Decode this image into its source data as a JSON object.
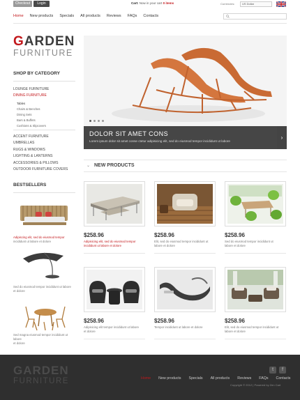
{
  "topbar": {
    "checkout": "Checkout",
    "login": "Login",
    "cart_label": "Cart:",
    "cart_text": "Now in your cart",
    "cart_items": "0 items",
    "currencies_label": "Currencies:",
    "currency_value": "US Dollar"
  },
  "nav": [
    "Home",
    "New products",
    "Specials",
    "All products",
    "Reviews",
    "FAQs",
    "Contacts"
  ],
  "logo": {
    "line1_first": "G",
    "line1_rest": "ARDEN",
    "line2": "FURNITURE"
  },
  "sidebar": {
    "category_heading": "SHOP BY CATEGORY",
    "categories_top": [
      "Lounge Furniture",
      "Dining Furniture"
    ],
    "subcategories": [
      "Tables",
      "Chairs & Benches",
      "Dining Sets",
      "Bars & Buffets",
      "Cushions & Slipcovers"
    ],
    "categories_bottom": [
      "Accent Furniture",
      "Umbrellas",
      "Rugs & Windows",
      "Lighting & Lanterns",
      "Accessories & Pillows",
      "Outdoor Furniture Covers"
    ],
    "bestsellers_heading": "BESTSELLERS",
    "bestsellers": [
      {
        "line1": "Adipiscing elit, sed do eiusmod tempor",
        "line2": "incididunt ut labore et dolore"
      },
      {
        "line1": "Sed do eiusmod tempor incididunt ut labore",
        "line2": "et dolore"
      },
      {
        "line1": "Sed magna eiusmod tempor incididunt ut labore",
        "line2": "et dolore"
      }
    ]
  },
  "slider": {
    "title": "DOLOR SIT AMET CONS",
    "text": "Lorem ipsum dolor sit amet conse ctetur adipisicing elit, sed do eiusmod tempor incididunt ut labore"
  },
  "new_products": {
    "heading": "NEW PRODUCTS",
    "items": [
      {
        "price": "$258.96",
        "line1": "Adipisicing elit, sed do eiusmod tempor",
        "line2": "incididunt ut labore et dolore",
        "highlight": true
      },
      {
        "price": "$258.96",
        "line1": "Elit, sed do eiusmod tempor incididunt ut",
        "line2": "labore et dolore",
        "highlight": false
      },
      {
        "price": "$258.96",
        "line1": "Sed do eiusmod tempor incididunt ut",
        "line2": "labore et dolore",
        "highlight": false
      },
      {
        "price": "$258.96",
        "line1": "Adipisicing elit tempor incididunt ut labore",
        "line2": "et dolore",
        "highlight": false
      },
      {
        "price": "$258.96",
        "line1": "Tempor incididunt ut labore et dolore",
        "line2": "",
        "highlight": false
      },
      {
        "price": "$258.96",
        "line1": "Elit, sed do eiusmod tempor incididunt ut",
        "line2": "labore et dolore",
        "highlight": false
      }
    ]
  },
  "footer": {
    "logo_line1": "GARDEN",
    "logo_line2": "FURNITURE",
    "nav": [
      "Home",
      "New products",
      "Specials",
      "All products",
      "Reviews",
      "FAQs",
      "Contacts"
    ],
    "copyright": "Copyright © 2012 | Powered by Zen Cart"
  },
  "colors": {
    "accent": "#c2171b",
    "footer_bg": "#2f2f2f",
    "caption_bg": "#2d2d2d"
  }
}
